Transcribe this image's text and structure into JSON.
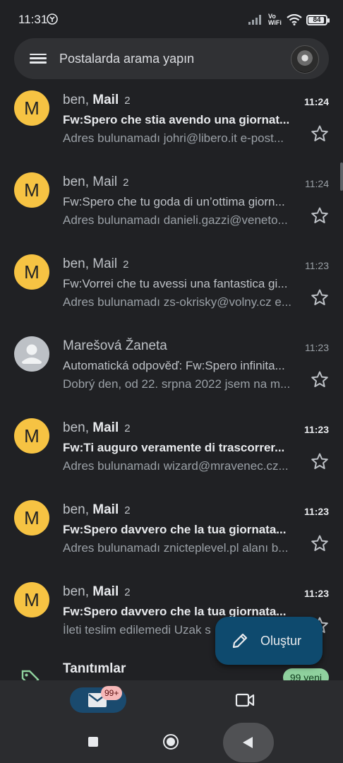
{
  "status_bar": {
    "time": "11:31",
    "volte_top": "Vo",
    "volte_bottom": "WiFi",
    "battery": "84"
  },
  "search": {
    "placeholder": "Postalarda arama yapın"
  },
  "emails": [
    {
      "avatar": "M",
      "sender_plain": "ben, ",
      "sender_bold": "Mail",
      "count": "2",
      "time": "11:24",
      "unread": true,
      "subject": "Fw:Spero che stia avendo una giornat...",
      "snippet": "Adres bulunamadı johri@libero.it e-post..."
    },
    {
      "avatar": "M",
      "sender_plain": "ben, Mail",
      "sender_bold": "",
      "count": "2",
      "time": "11:24",
      "unread": false,
      "subject": "Fw:Spero che tu goda di un’ottima giorn...",
      "snippet": "Adres bulunamadı danieli.gazzi@veneto..."
    },
    {
      "avatar": "M",
      "sender_plain": "ben, Mail",
      "sender_bold": "",
      "count": "2",
      "time": "11:23",
      "unread": false,
      "subject": "Fw:Vorrei che tu avessi una fantastica gi...",
      "snippet": "Adres bulunamadı zs-okrisky@volny.cz e..."
    },
    {
      "avatar": "",
      "sender_plain": "Marešová Žaneta",
      "sender_bold": "",
      "count": "",
      "time": "11:23",
      "unread": false,
      "subject": "Automatická odpověď: Fw:Spero infinita...",
      "snippet": "Dobrý den, od 22. srpna 2022 jsem na m..."
    },
    {
      "avatar": "M",
      "sender_plain": "ben, ",
      "sender_bold": "Mail",
      "count": "2",
      "time": "11:23",
      "unread": true,
      "subject": "Fw:Ti auguro veramente di trascorrer...",
      "snippet": "Adres bulunamadı wizard@mravenec.cz..."
    },
    {
      "avatar": "M",
      "sender_plain": "ben, ",
      "sender_bold": "Mail",
      "count": "2",
      "time": "11:23",
      "unread": true,
      "subject": "Fw:Spero davvero che la tua giornata...",
      "snippet": "Adres bulunamadı znicteplevel.pl alanı b..."
    },
    {
      "avatar": "M",
      "sender_plain": "ben, ",
      "sender_bold": "Mail",
      "count": "2",
      "time": "11:23",
      "unread": true,
      "subject": "Fw:Spero davvero che la tua giornata...",
      "snippet": "İleti teslim edilemedi Uzak s"
    }
  ],
  "promotions": {
    "label": "Tanıtımlar",
    "badge": "99 yeni"
  },
  "compose": {
    "label": "Oluştur"
  },
  "bottom_nav": {
    "mail_badge": "99+"
  },
  "colors": {
    "background": "#202124",
    "avatar_yellow": "#f6c343",
    "fab": "#0e4a6e",
    "promo_badge": "#8fd19e"
  }
}
